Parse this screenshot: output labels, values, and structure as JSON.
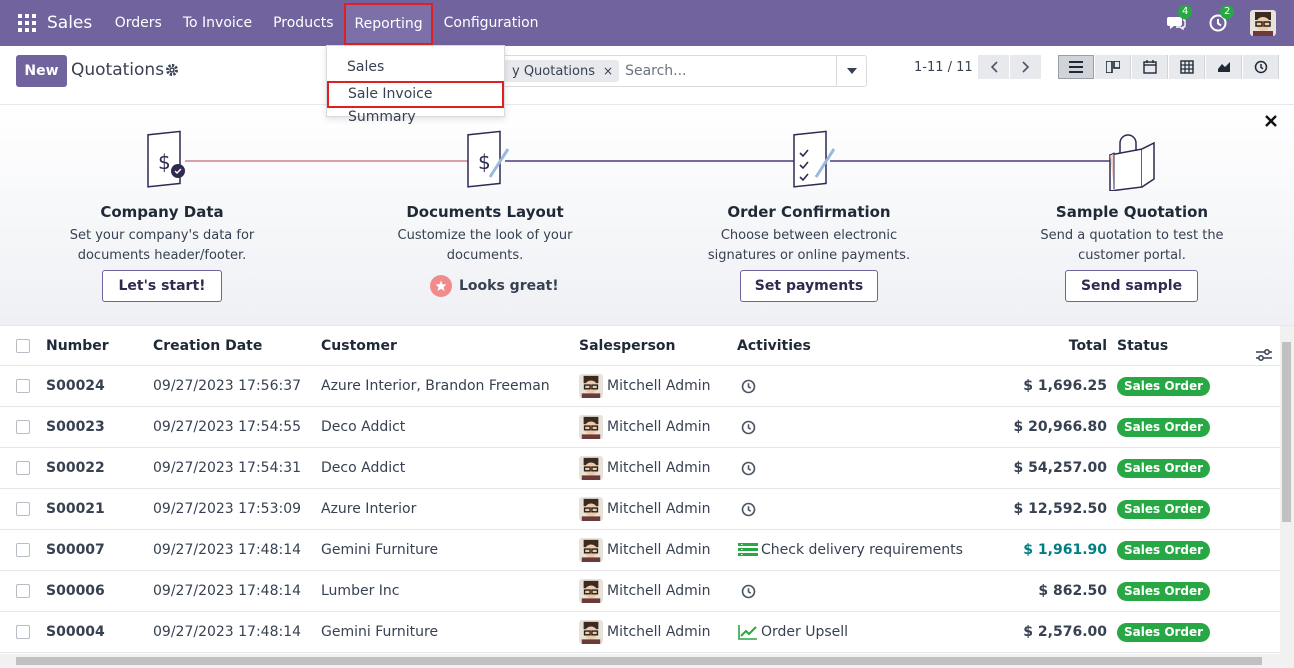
{
  "navbar": {
    "app_name": "Sales",
    "menu": [
      "Orders",
      "To Invoice",
      "Products",
      "Reporting",
      "Configuration"
    ],
    "active_menu": "Reporting",
    "messages_count": "4",
    "activities_count": "2"
  },
  "dropdown": {
    "items": [
      "Sales",
      "Sale Invoice Summary"
    ],
    "highlighted": "Sale Invoice Summary"
  },
  "control_panel": {
    "new_label": "New",
    "title": "Quotations",
    "facet_label": "y Quotations",
    "facet_remove": "×",
    "search_placeholder": "Search...",
    "pager": "1-11 / 11"
  },
  "onboarding": {
    "steps": [
      {
        "title": "Company Data",
        "desc": "Set your company's data for documents header/footer.",
        "button": "Let's start!"
      },
      {
        "title": "Documents Layout",
        "desc": "Customize the look of your documents.",
        "done_label": "Looks great!"
      },
      {
        "title": "Order Confirmation",
        "desc": "Choose between electronic signatures or online payments.",
        "button": "Set payments"
      },
      {
        "title": "Sample Quotation",
        "desc": "Send a quotation to test the customer portal.",
        "button": "Send sample"
      }
    ],
    "close": "×"
  },
  "table": {
    "headers": {
      "number": "Number",
      "date": "Creation Date",
      "customer": "Customer",
      "salesperson": "Salesperson",
      "activities": "Activities",
      "total": "Total",
      "status": "Status"
    },
    "rows": [
      {
        "number": "S00024",
        "date": "09/27/2023 17:56:37",
        "customer": "Azure Interior, Brandon Freeman",
        "salesperson": "Mitchell Admin",
        "activity": "",
        "activity_icon": "clock-icon",
        "total": "$ 1,696.25",
        "status": "Sales Order"
      },
      {
        "number": "S00023",
        "date": "09/27/2023 17:54:55",
        "customer": "Deco Addict",
        "salesperson": "Mitchell Admin",
        "activity": "",
        "activity_icon": "clock-icon",
        "total": "$ 20,966.80",
        "status": "Sales Order"
      },
      {
        "number": "S00022",
        "date": "09/27/2023 17:54:31",
        "customer": "Deco Addict",
        "salesperson": "Mitchell Admin",
        "activity": "",
        "activity_icon": "clock-icon",
        "total": "$ 54,257.00",
        "status": "Sales Order"
      },
      {
        "number": "S00021",
        "date": "09/27/2023 17:53:09",
        "customer": "Azure Interior",
        "salesperson": "Mitchell Admin",
        "activity": "",
        "activity_icon": "clock-icon",
        "total": "$ 12,592.50",
        "status": "Sales Order"
      },
      {
        "number": "S00007",
        "date": "09/27/2023 17:48:14",
        "customer": "Gemini Furniture",
        "salesperson": "Mitchell Admin",
        "activity": "Check delivery requirements",
        "activity_icon": "list-icon",
        "total": "$ 1,961.90",
        "status": "Sales Order"
      },
      {
        "number": "S00006",
        "date": "09/27/2023 17:48:14",
        "customer": "Lumber Inc",
        "salesperson": "Mitchell Admin",
        "activity": "",
        "activity_icon": "clock-icon",
        "total": "$ 862.50",
        "status": "Sales Order"
      },
      {
        "number": "S00004",
        "date": "09/27/2023 17:48:14",
        "customer": "Gemini Furniture",
        "salesperson": "Mitchell Admin",
        "activity": "Order Upsell",
        "activity_icon": "chart-line-icon",
        "total": "$ 2,576.00",
        "status": "Sales Order"
      }
    ]
  },
  "colors": {
    "brand": "#71639e",
    "status_green": "#28a745",
    "highlight_red": "#e02020",
    "link_teal": "#017e84"
  }
}
